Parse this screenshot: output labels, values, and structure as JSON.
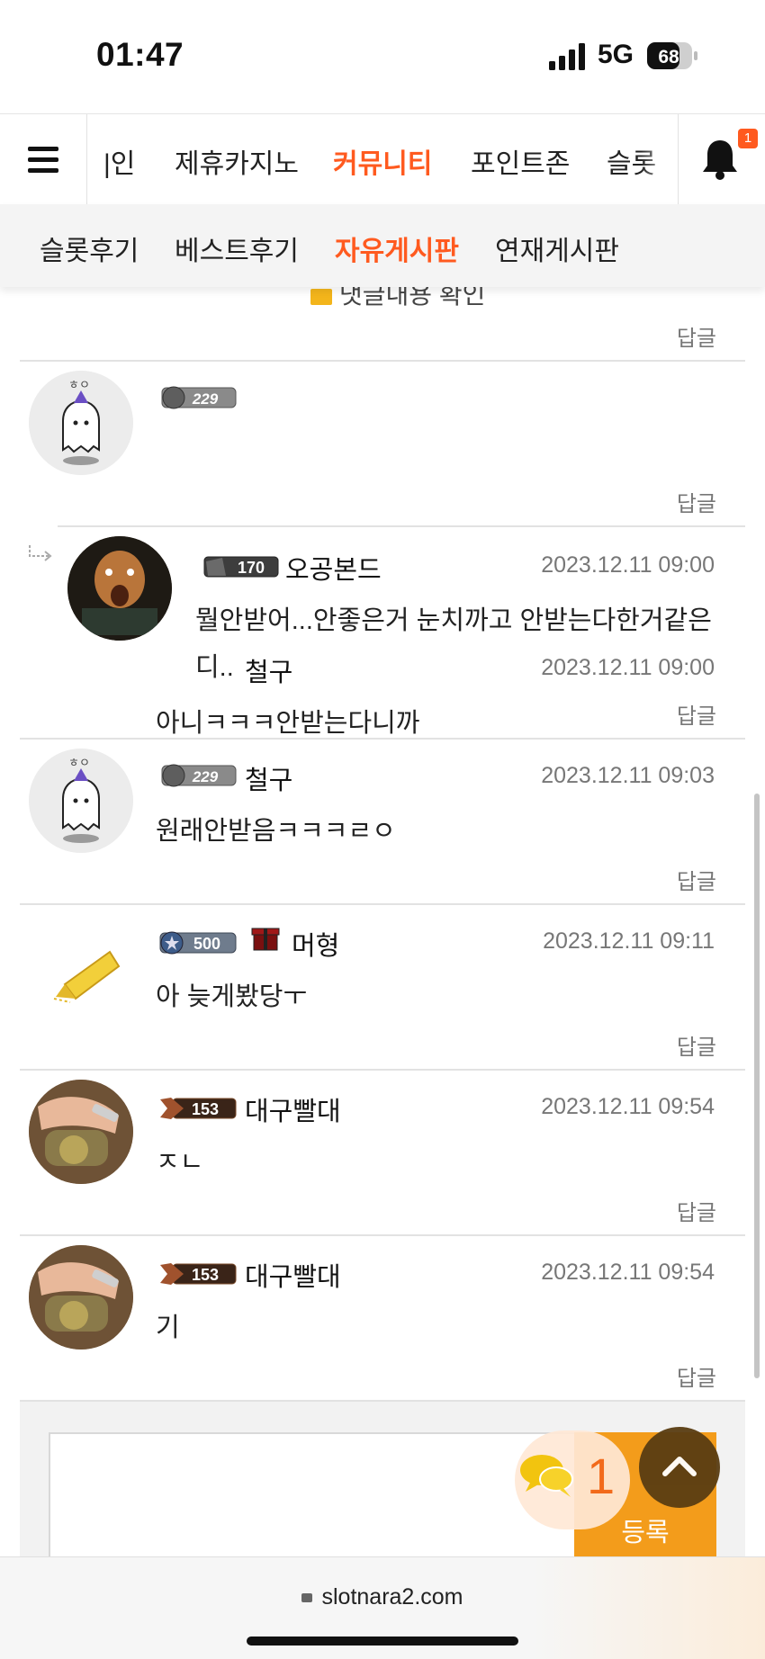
{
  "status_bar": {
    "time": "01:47",
    "network": "5G",
    "battery": "68"
  },
  "nav": {
    "tabs": [
      "|인",
      "제휴카지노",
      "커뮤니티",
      "포인트존",
      "슬롯"
    ],
    "active_tab": "커뮤니티",
    "notification_count": "1"
  },
  "subnav": {
    "items": [
      "슬롯후기",
      "베스트후기",
      "자유게시판",
      "연재게시판"
    ],
    "active": "자유게시판"
  },
  "partial_top": {
    "text": "댓글내용 확인",
    "reply": "답글"
  },
  "comments": [
    {
      "nick": "철구",
      "level": "229",
      "date": "2023.12.11 09:00",
      "text": "아니ㅋㅋㅋ안받는다니까",
      "reply": "답글",
      "avatar": "ghost-avatar"
    },
    {
      "nick": "오공본드",
      "level": "170",
      "date": "2023.12.11 09:00",
      "text_line1": "뭘안받어...안좋은거 눈치까고 안받는다한거같은",
      "text_line2": "디..",
      "reply": "답글",
      "avatar": "photo-avatar",
      "is_reply": true
    },
    {
      "nick": "철구",
      "level": "229",
      "date": "2023.12.11 09:03",
      "text": "원래안받음ㅋㅋㅋㄹㅇ",
      "reply": "답글",
      "avatar": "ghost-avatar"
    },
    {
      "nick": "머형",
      "level": "500",
      "date": "2023.12.11 09:11",
      "text": "아 늦게봤당ㅜ",
      "reply": "답글",
      "avatar": "marker-avatar"
    },
    {
      "nick": "대구빨대",
      "level": "153",
      "date": "2023.12.11 09:54",
      "text": "ㅈㄴ",
      "reply": "답글",
      "avatar": "hand-avatar"
    },
    {
      "nick": "대구빨대",
      "level": "153",
      "date": "2023.12.11 09:54",
      "text": "기",
      "reply": "답글",
      "avatar": "hand-avatar"
    }
  ],
  "comment_form": {
    "submit_label": "등록",
    "comment_count": "1"
  },
  "browser": {
    "url": "slotnara2.com"
  },
  "colors": {
    "accent": "#ff5a1f",
    "submit": "#f39c1b"
  }
}
